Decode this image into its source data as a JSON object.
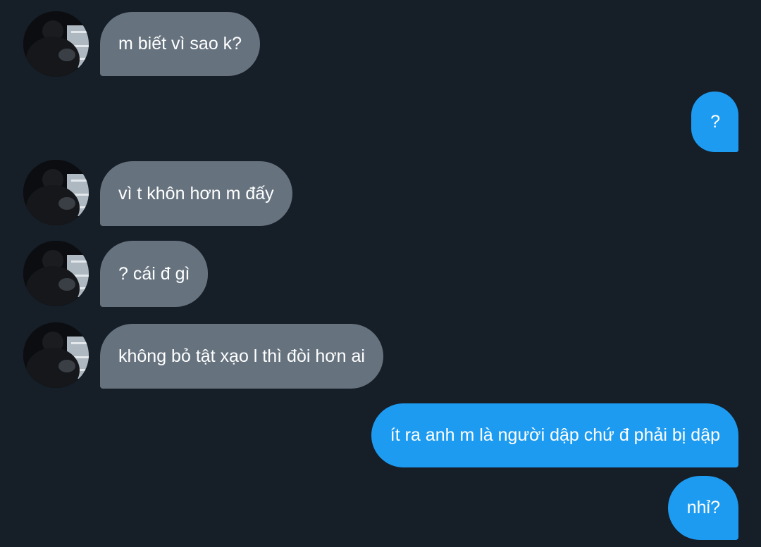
{
  "conversation": {
    "messages": [
      {
        "direction": "incoming",
        "text": "m biết vì sao k?",
        "has_avatar": true
      },
      {
        "direction": "outgoing",
        "text": "?"
      },
      {
        "direction": "incoming",
        "text": "vì t khôn hơn m đấy",
        "has_avatar": true
      },
      {
        "direction": "incoming",
        "text": "? cái đ gì",
        "has_avatar": true
      },
      {
        "direction": "incoming",
        "text": "không bỏ tật xạo l thì đòi hơn ai",
        "has_avatar": true
      },
      {
        "direction": "outgoing",
        "text": "ít ra anh m là người dập chứ đ phải bị dập"
      },
      {
        "direction": "outgoing",
        "text": "nhỉ?"
      }
    ]
  },
  "colors": {
    "background": "#161e28",
    "incoming_bubble": "#66737f",
    "outgoing_bubble": "#1d9bf0",
    "text": "#ffffff"
  },
  "icons": {
    "avatar": "user-avatar-photo"
  }
}
